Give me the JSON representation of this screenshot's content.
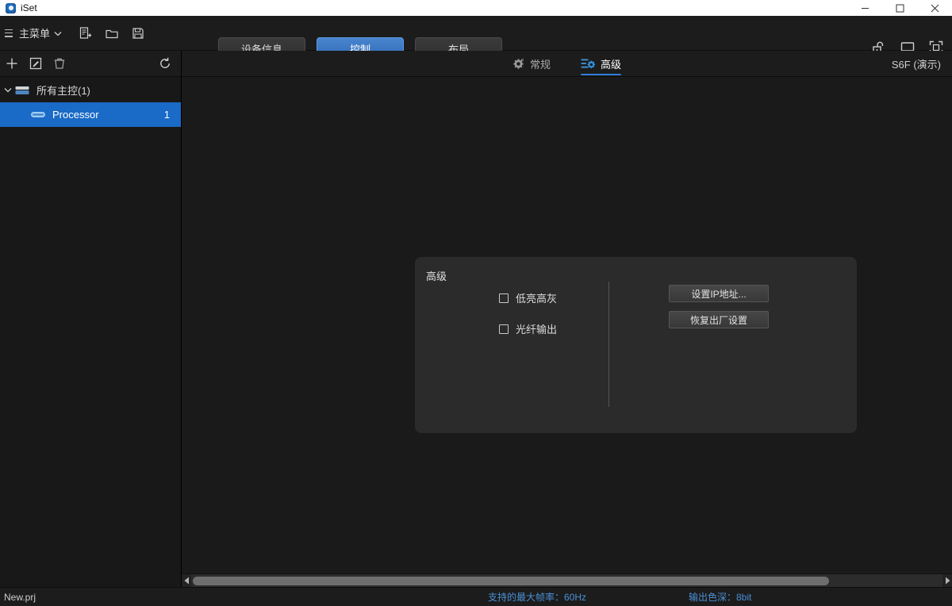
{
  "window": {
    "title": "iSet",
    "app_icon": "app-logo-icon",
    "controls": [
      {
        "name": "minimize-button",
        "glyph": "minimize-icon"
      },
      {
        "name": "maximize-button",
        "glyph": "maximize-icon"
      },
      {
        "name": "close-button",
        "glyph": "close-icon"
      }
    ]
  },
  "menubar": {
    "hamburger": "hamburger-icon",
    "main_menu_label": "主菜单",
    "chevron": "chevron-down-icon",
    "tools": [
      {
        "name": "new-project-icon",
        "title": "新建"
      },
      {
        "name": "open-project-icon",
        "title": "打开"
      },
      {
        "name": "save-project-icon",
        "title": "保存"
      }
    ],
    "mode_buttons": [
      {
        "label": "设备信息",
        "active": false,
        "name": "device-info"
      },
      {
        "label": "控制",
        "active": true,
        "name": "control"
      },
      {
        "label": "布局",
        "active": false,
        "name": "layout"
      }
    ],
    "right_icons": [
      {
        "name": "unlock-icon"
      },
      {
        "name": "monitor-icon"
      },
      {
        "name": "fullscreen-icon"
      }
    ]
  },
  "sidebar": {
    "tools": [
      {
        "name": "add-icon"
      },
      {
        "name": "edit-icon"
      },
      {
        "name": "delete-icon"
      },
      {
        "name": "refresh-icon"
      }
    ],
    "tree": {
      "root": {
        "label": "所有主控(1)",
        "expanded": true
      },
      "children": [
        {
          "label": "Processor",
          "count": "1",
          "selected": true
        }
      ]
    }
  },
  "main": {
    "tabs": [
      {
        "label": "常规",
        "icon": "gear-icon",
        "active": false
      },
      {
        "label": "高级",
        "icon": "advanced-settings-icon",
        "active": true
      }
    ],
    "device_name": "S6F (演示)"
  },
  "panel": {
    "title": "高级",
    "checkboxes": [
      {
        "label": "低亮高灰",
        "checked": false
      },
      {
        "label": "光纤输出",
        "checked": false
      }
    ],
    "buttons": [
      {
        "label": "设置IP地址...",
        "name": "set-ip-address"
      },
      {
        "label": "恢复出厂设置",
        "name": "factory-reset"
      }
    ]
  },
  "scrollbar": {
    "left_arrow": "scroll-left-icon",
    "right_arrow": "scroll-right-icon"
  },
  "statusbar": {
    "file": "New.prj",
    "max_frame_rate": "支持的最大帧率：60Hz",
    "color_depth": "输出色深：8bit"
  },
  "colors": {
    "accent_blue": "#2f7ddb",
    "selection_blue": "#1a6ac7",
    "status_blue": "#4a8fd6",
    "panel_bg": "#2b2b2b",
    "app_bg": "#1a1a1a"
  }
}
